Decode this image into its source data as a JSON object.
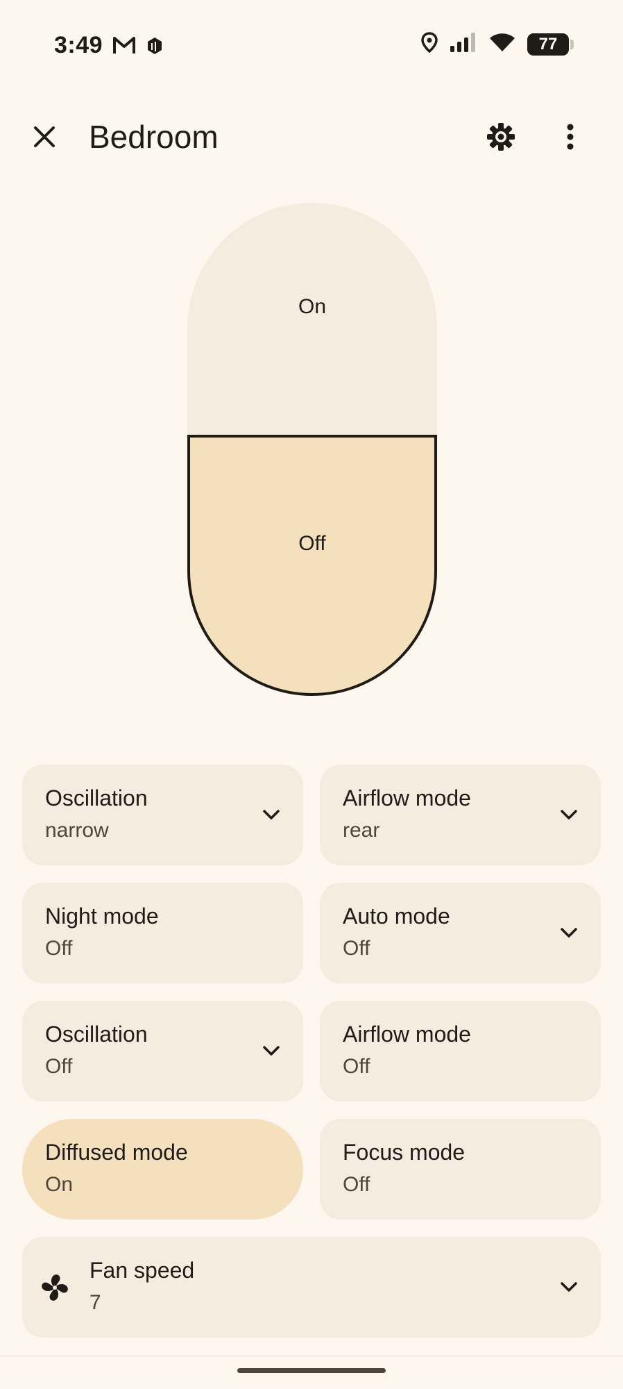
{
  "status_bar": {
    "time": "3:49",
    "battery": "77",
    "icons": [
      "gmail-icon",
      "app-notification-icon",
      "location-icon",
      "signal-icon",
      "wifi-icon",
      "battery-icon"
    ]
  },
  "header": {
    "title": "Bedroom",
    "icons": [
      "close-icon",
      "gear-icon",
      "more-vert-icon"
    ]
  },
  "power_toggle": {
    "on_label": "On",
    "off_label": "Off",
    "selected": "off"
  },
  "tiles": [
    {
      "title": "Oscillation",
      "value": "narrow",
      "has_dropdown": true,
      "active": false
    },
    {
      "title": "Airflow mode",
      "value": "rear",
      "has_dropdown": true,
      "active": false
    },
    {
      "title": "Night mode",
      "value": "Off",
      "has_dropdown": false,
      "active": false
    },
    {
      "title": "Auto mode",
      "value": "Off",
      "has_dropdown": true,
      "active": false
    },
    {
      "title": "Oscillation",
      "value": "Off",
      "has_dropdown": true,
      "active": false
    },
    {
      "title": "Airflow mode",
      "value": "Off",
      "has_dropdown": false,
      "active": false
    },
    {
      "title": "Diffused mode",
      "value": "On",
      "has_dropdown": false,
      "active": true
    },
    {
      "title": "Focus mode",
      "value": "Off",
      "has_dropdown": false,
      "active": false
    }
  ],
  "fan_speed": {
    "title": "Fan speed",
    "value": "7",
    "icon": "fan-icon"
  },
  "colors": {
    "background": "#fef7ef",
    "tile": "#f5ece0",
    "accent": "#f5e0bd",
    "text": "#1f1b16"
  }
}
